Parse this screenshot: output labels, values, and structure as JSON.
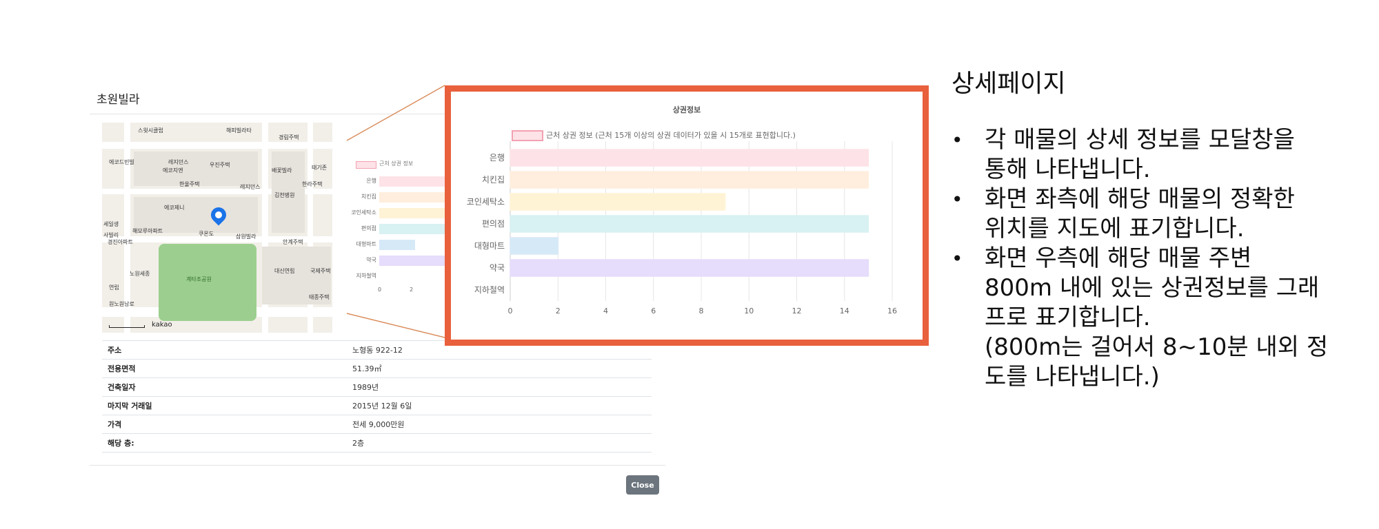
{
  "modal": {
    "title": "초원빌라",
    "close_label": "Close",
    "map": {
      "labels": [
        "스윗시클럽",
        "해피빌라타",
        "경림주택",
        "에코드빈빌",
        "레지던스",
        "우진주택",
        "에코지엔",
        "배꽃빌라",
        "태기존",
        "한울주택",
        "레지던스",
        "김천병원",
        "한라주택",
        "에코제니",
        "쿠온도",
        "삼원빌라",
        "안계주택",
        "해모루아파트",
        "세일생",
        "노원세종",
        "경진아파트",
        "사빌리",
        "대신연립",
        "국제주택",
        "태종주택",
        "연립",
        "원노원남로",
        "계타조공원"
      ],
      "logo": "kakao"
    },
    "mini_chart": {
      "legend": "근처 상권 정보",
      "categories": [
        "은행",
        "치킨집",
        "코인세탁소",
        "편의점",
        "대형마트",
        "약국",
        "지하철역"
      ],
      "ticks": [
        "0",
        "2"
      ]
    },
    "table": [
      {
        "key": "주소",
        "value": "노형동 922-12"
      },
      {
        "key": "전용면적",
        "value": "51.39㎡"
      },
      {
        "key": "건축일자",
        "value": "1989년"
      },
      {
        "key": "마지막 거래일",
        "value": "2015년 12월 6일"
      },
      {
        "key": "가격",
        "value": "전세 9,000만원"
      },
      {
        "key": "해당 층:",
        "value": "2층"
      }
    ]
  },
  "chart_data": {
    "type": "bar",
    "orientation": "horizontal",
    "title": "상권정보",
    "legend": "근처 상권 정보 (근처 15개 이상의 상권 데이터가 있을 시 15개로 표현합니다.)",
    "categories": [
      "은행",
      "치킨집",
      "코인세탁소",
      "편의점",
      "대형마트",
      "약국",
      "지하철역"
    ],
    "values": [
      15,
      15,
      9,
      15,
      2,
      15,
      0
    ],
    "colors": [
      "#fde2e7",
      "#ffeedd",
      "#fff3d6",
      "#d8f1f2",
      "#d6e9f7",
      "#e6dcfb",
      "#eeeeee"
    ],
    "xlim": [
      0,
      16
    ],
    "xticks": [
      0,
      2,
      4,
      6,
      8,
      10,
      12,
      14,
      16
    ],
    "grid": true
  },
  "description": {
    "title": "상세페이지",
    "items": [
      "각 매물의 상세 정보를 모달창을\n통해 나타냅니다.",
      "화면 좌측에 해당 매물의 정확한\n위치를 지도에 표기합니다.",
      "화면 우측에 해당 매물 주변\n800m 내에 있는 상권정보를 그래\n프로 표기합니다.\n(800m는 걸어서 8~10분 내외 정\n도를 나타냅니다.)"
    ]
  }
}
